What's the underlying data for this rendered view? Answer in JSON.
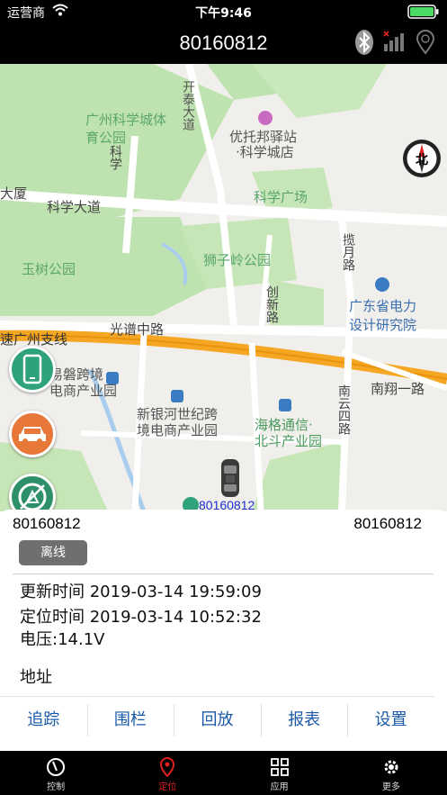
{
  "status_bar": {
    "carrier": "运营商",
    "time": "下午9:46"
  },
  "title_bar": {
    "title": "80160812"
  },
  "map": {
    "labels": {
      "science_city_park": "广州科学城体育公园",
      "kaitai_road": "开泰大道",
      "youtuo": "优托邦驿站",
      "science_city_store": "·科学城店",
      "science_ave": "科学大道",
      "building": "大厦",
      "science_square": "科学广场",
      "yushu_park": "玉树公园",
      "shizi_park": "狮子岭公园",
      "lanyue_road": "揽月路",
      "chuangxin_road": "创新路",
      "power_institute_1": "广东省电力",
      "power_institute_2": "设计研究院",
      "guangpu_mid_road": "光谱中路",
      "expressway": "速广州支线",
      "nanxiang_road": "南翔一路",
      "nanyun_road": "南云四路",
      "yipan_1": "易磐跨境",
      "yipan_2": "电商产业园",
      "xinyin_1": "新银河世纪跨",
      "xinyin_2": "境电商产业园",
      "haige_1": "海格通信·",
      "haige_2": "北斗产业园",
      "kexue_road": "科学",
      "guang_road": "路"
    },
    "car_label": "80160812",
    "compass_label": "北"
  },
  "panel": {
    "device_left": "80160812",
    "device_right": "80160812",
    "status_badge": "离线",
    "update_time": "更新时间 2019-03-14 19:59:09",
    "locate_time": "定位时间 2019-03-14 10:52:32",
    "voltage": "电压:14.1V",
    "address": "地址"
  },
  "actions": [
    "追踪",
    "围栏",
    "回放",
    "报表",
    "设置"
  ],
  "tabs": [
    {
      "label": "控制",
      "icon": "steering-wheel-icon"
    },
    {
      "label": "定位",
      "icon": "location-pin-icon"
    },
    {
      "label": "应用",
      "icon": "grid-icon"
    },
    {
      "label": "更多",
      "icon": "gear-icon"
    }
  ],
  "active_tab": "定位",
  "colors": {
    "accent_blue": "#1b5aa8",
    "active_tab": "#e02020",
    "park_green": "#bfe3b0",
    "highway_orange": "#f5a623"
  }
}
